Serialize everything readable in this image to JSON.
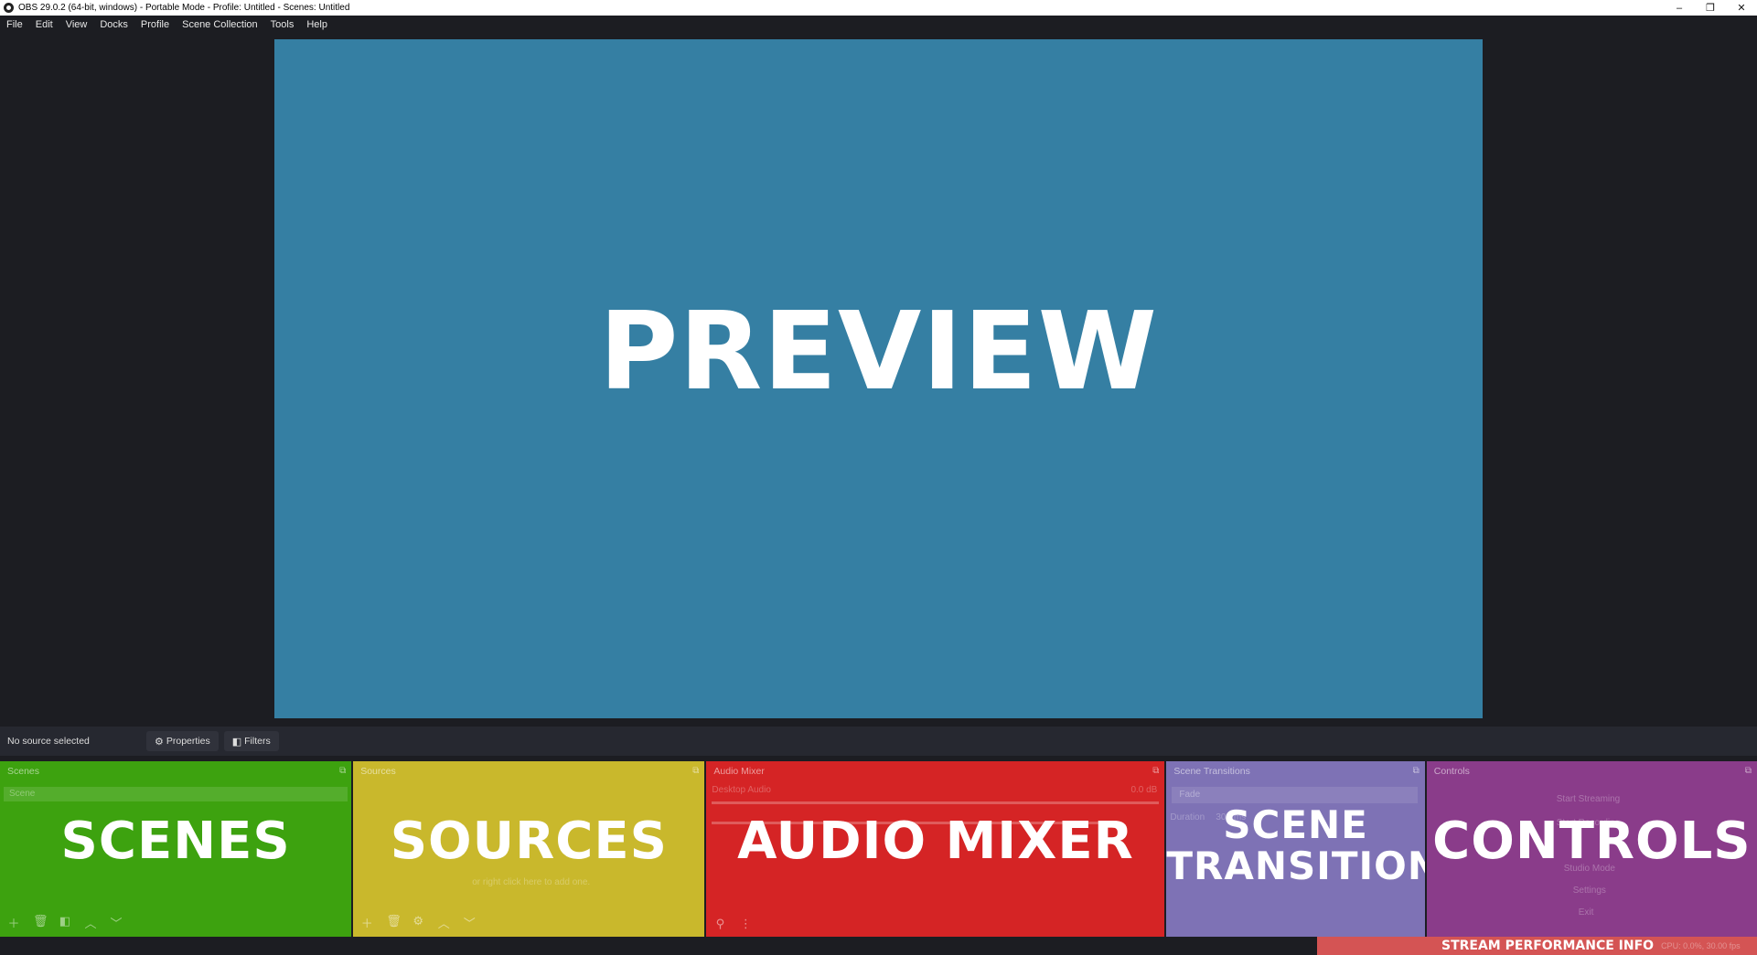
{
  "window": {
    "title": "OBS 29.0.2 (64-bit, windows) - Portable Mode - Profile: Untitled - Scenes: Untitled",
    "minimize": "–",
    "restore": "❐",
    "close": "✕"
  },
  "menu": [
    "File",
    "Edit",
    "View",
    "Docks",
    "Profile",
    "Scene Collection",
    "Tools",
    "Help"
  ],
  "preview": {
    "label": "PREVIEW"
  },
  "context_bar": {
    "status": "No source selected",
    "properties_label": "Properties",
    "properties_icon": "gear-icon",
    "filters_label": "Filters",
    "filters_icon": "filter-icon"
  },
  "docks": {
    "scenes": {
      "title": "Scenes",
      "label": "SCENES",
      "items": [
        "Scene"
      ],
      "color": "#3da20f"
    },
    "sources": {
      "title": "Sources",
      "label": "SOURCES",
      "hint": "or right click here to add one.",
      "color": "#c9b82c"
    },
    "audio": {
      "title": "Audio Mixer",
      "label": "AUDIO MIXER",
      "channel": "Desktop Audio",
      "level": "0.0 dB",
      "color": "#d52425"
    },
    "transitions": {
      "title": "Scene Transitions",
      "label_line1": "SCENE",
      "label_line2": "TRANSITIONS",
      "selected": "Fade",
      "duration_label": "Duration",
      "duration_value": "300 ms",
      "color": "#7e72b5"
    },
    "controls": {
      "title": "Controls",
      "label": "CONTROLS",
      "buttons": [
        "Start Streaming",
        "Start Recording",
        "Studio Mode",
        "Settings",
        "Exit"
      ],
      "color": "#8a3c8a"
    }
  },
  "status_bar": {
    "label": "STREAM PERFORMANCE INFO",
    "stats": "CPU: 0.0%, 30.00 fps"
  }
}
